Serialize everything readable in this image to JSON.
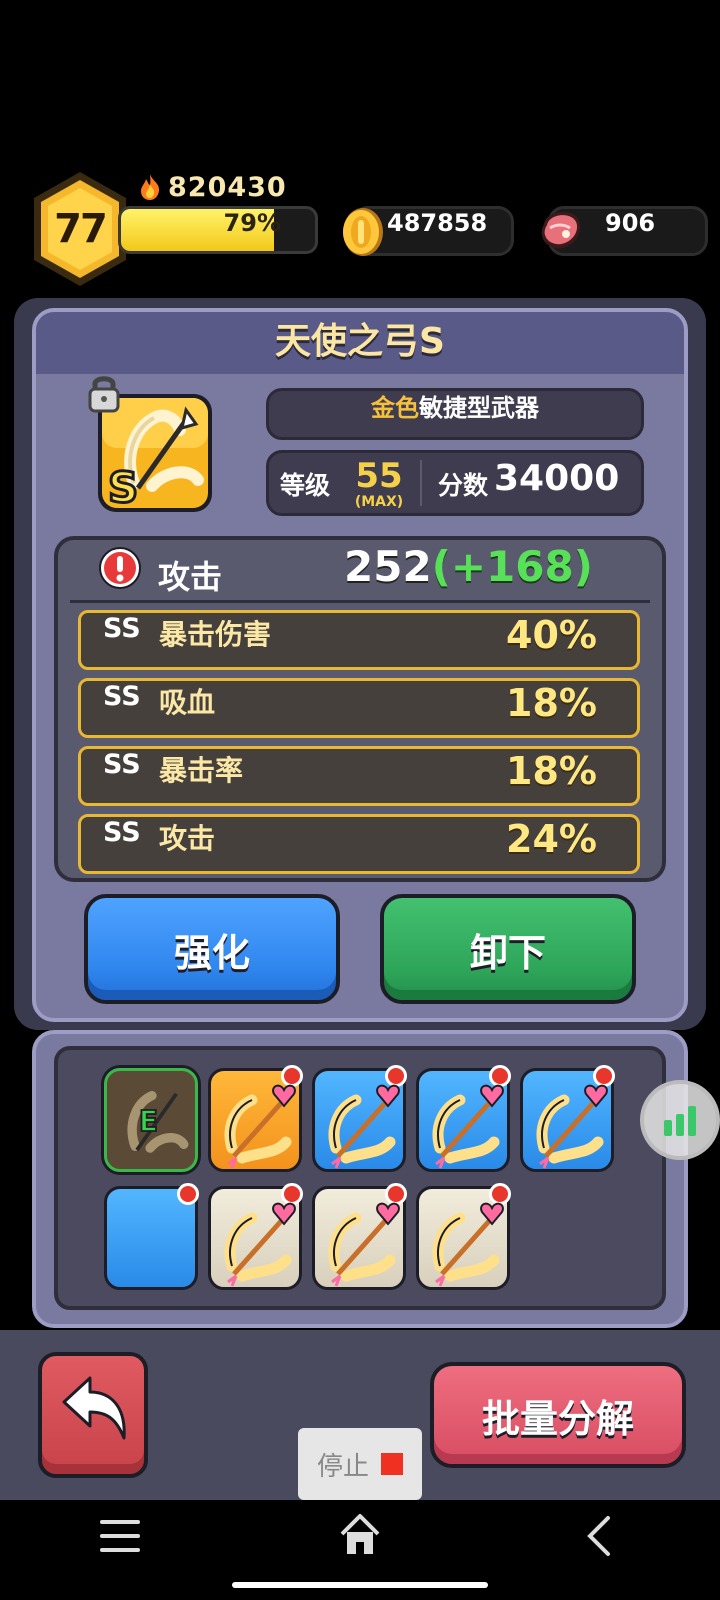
{
  "player": {
    "level": "77",
    "power": "820430",
    "xp_percent": 79,
    "xp_text": "79%"
  },
  "resources": {
    "gold": "487858",
    "meat": "906"
  },
  "item": {
    "name": "天使之弓S",
    "rarity_word": "金色",
    "type_word": "敏捷型武器",
    "level_label": "等级",
    "level_value": "55",
    "level_max": "(MAX)",
    "score_label": "分数",
    "score_value": "34000",
    "main_stat": {
      "label": "攻击",
      "value": "252",
      "bonus": "(+168)"
    },
    "sub_stats": [
      {
        "grade": "SS",
        "name": "暴击伤害",
        "value": "40%"
      },
      {
        "grade": "SS",
        "name": "吸血",
        "value": "18%"
      },
      {
        "grade": "SS",
        "name": "暴击率",
        "value": "18%"
      },
      {
        "grade": "SS",
        "name": "攻击",
        "value": "24%"
      }
    ]
  },
  "buttons": {
    "enhance": "强化",
    "unequip": "卸下",
    "batch_salvage": "批量分解",
    "stop": "停止"
  },
  "inventory": {
    "equipped_badge": "E"
  },
  "colors": {
    "accent_gold": "#f6c03c",
    "bonus_green": "#58e058",
    "enhance_blue": "#2f86ee",
    "unequip_green": "#2ea65a",
    "salvage_pink": "#d84c62"
  }
}
